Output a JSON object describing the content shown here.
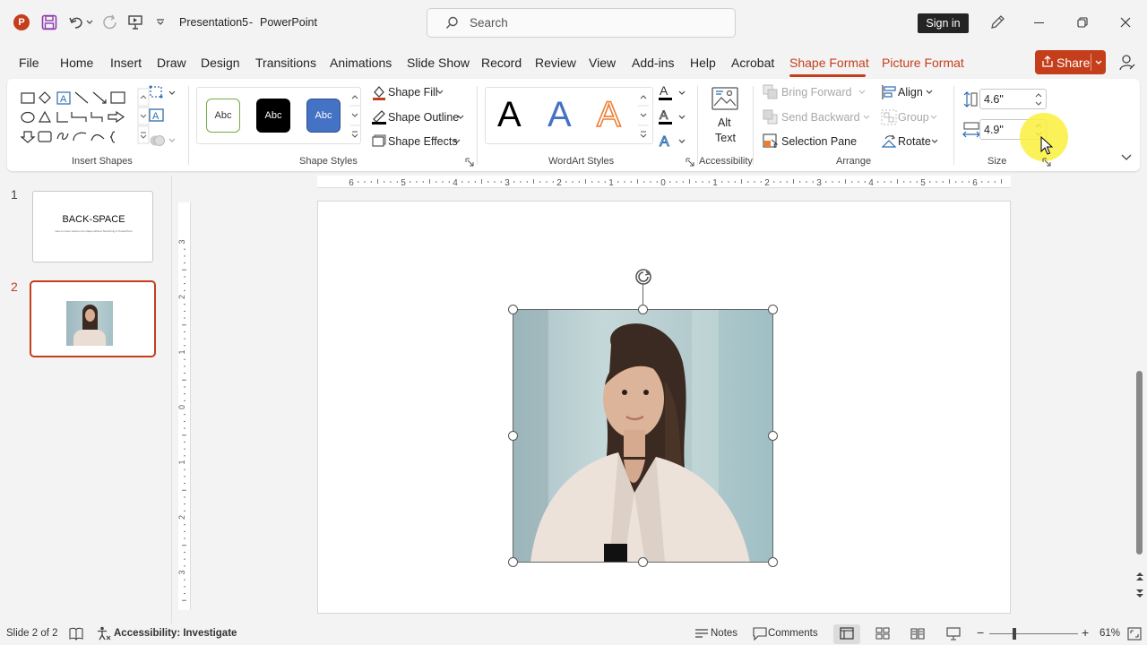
{
  "titlebar": {
    "file_name": "Presentation5",
    "separator": "-",
    "app_name": "PowerPoint",
    "search_placeholder": "Search",
    "sign_in": "Sign in"
  },
  "menu_tabs": [
    "File",
    "Home",
    "Insert",
    "Draw",
    "Design",
    "Transitions",
    "Animations",
    "Slide Show",
    "Record",
    "Review",
    "View",
    "Add-ins",
    "Help",
    "Acrobat",
    "Shape Format",
    "Picture Format"
  ],
  "active_tab": "Shape Format",
  "share_label": "Share",
  "ribbon": {
    "insert_shapes_label": "Insert Shapes",
    "shape_styles_label": "Shape Styles",
    "style_samples": [
      "Abc",
      "Abc",
      "Abc"
    ],
    "shape_fill": "Shape Fill",
    "shape_outline": "Shape Outline",
    "shape_effects": "Shape Effects",
    "wordart_label": "WordArt Styles",
    "wordart_samples": [
      "A",
      "A",
      "A"
    ],
    "alt_text_1": "Alt",
    "alt_text_2": "Text",
    "accessibility_label": "Accessibility",
    "bring_forward": "Bring Forward",
    "send_backward": "Send Backward",
    "selection_pane": "Selection Pane",
    "align": "Align",
    "group": "Group",
    "rotate": "Rotate",
    "arrange_label": "Arrange",
    "height_value": "4.6\"",
    "width_value": "4.9\"",
    "size_label": "Size"
  },
  "ruler": {
    "top_ticks": [
      "6",
      "5",
      "4",
      "3",
      "2",
      "1",
      "0",
      "1",
      "2",
      "3",
      "4",
      "5",
      "6"
    ],
    "left_ticks": [
      "3",
      "2",
      "1",
      "0",
      "1",
      "2",
      "3"
    ]
  },
  "thumbnails": [
    {
      "number": "1",
      "title": "BACK-SPACE",
      "subtitle": "How to insert picture into shape without Stretching in PowerPoint"
    },
    {
      "number": "2"
    }
  ],
  "statusbar": {
    "slide_info": "Slide 2 of 2",
    "accessibility": "Accessibility: Investigate",
    "notes": "Notes",
    "comments": "Comments",
    "zoom_minus": "−",
    "zoom_plus": "+",
    "zoom": "61%"
  },
  "colors": {
    "accent": "#c43e1c",
    "share_bg": "#c43e1c",
    "style_green": "#70ad47",
    "style_blue": "#4472c4",
    "wordart_orange": "#ed7d31"
  }
}
